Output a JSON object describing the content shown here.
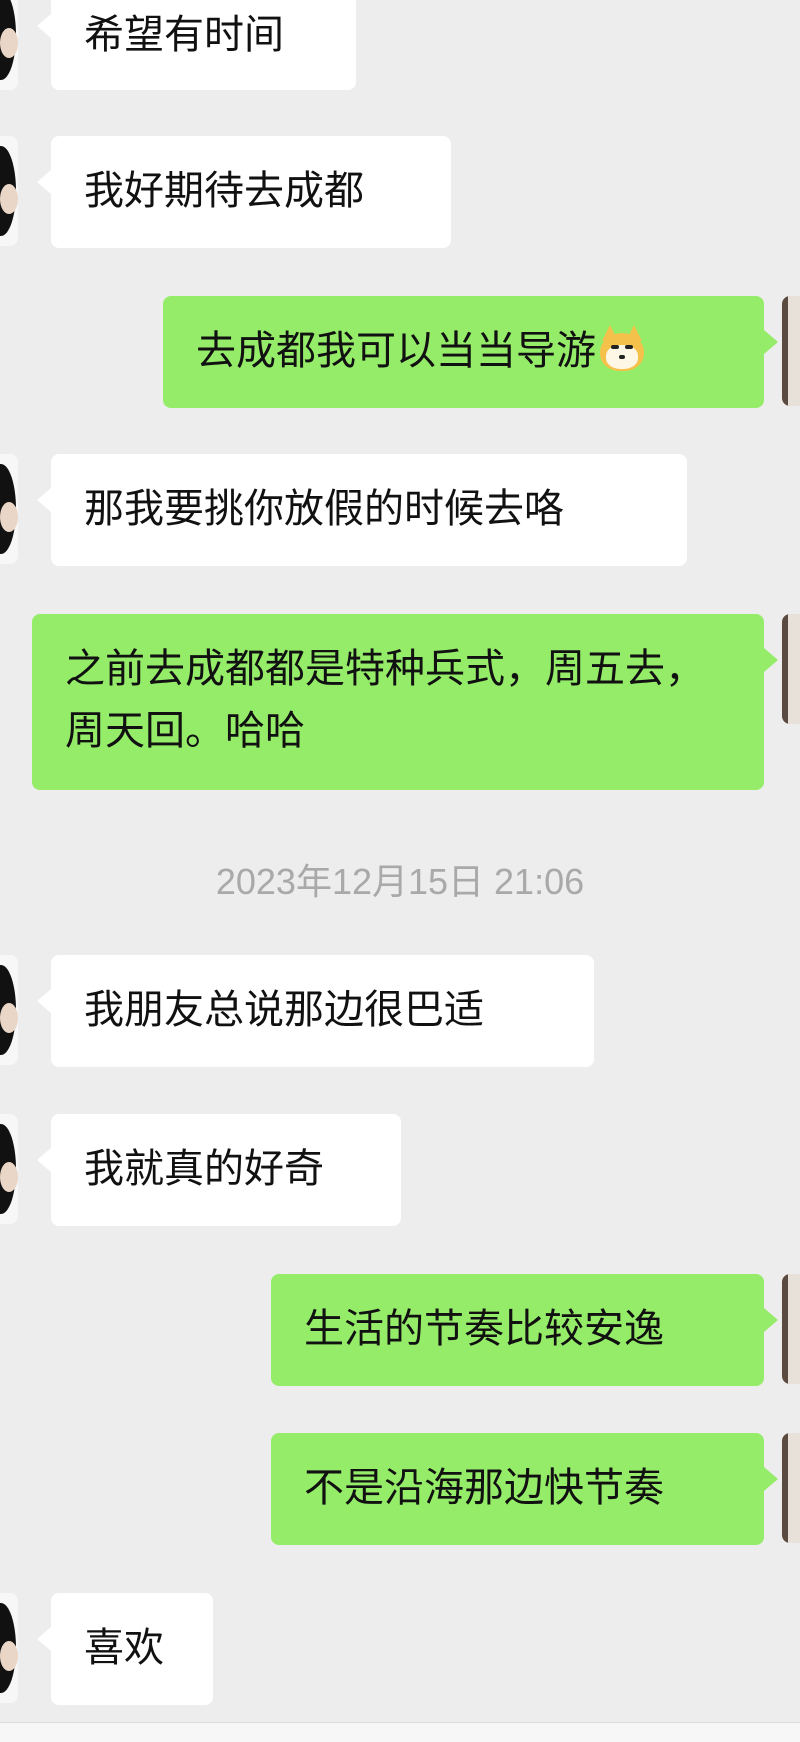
{
  "messages": [
    {
      "side": "in",
      "text": "希望有时间"
    },
    {
      "side": "in",
      "text": "我好期待去成都"
    },
    {
      "side": "out",
      "text": "去成都我可以当当导游",
      "emoji": "doge-emoji-icon"
    },
    {
      "side": "in",
      "text": "那我要挑你放假的时候去咯"
    },
    {
      "side": "out",
      "text": "之前去成都都是特种兵式，周五去，周天回。哈哈"
    },
    {
      "side": "in",
      "text": "我朋友总说那边很巴适"
    },
    {
      "side": "in",
      "text": "我就真的好奇"
    },
    {
      "side": "out",
      "text": "生活的节奏比较安逸"
    },
    {
      "side": "out",
      "text": "不是沿海那边快节奏"
    },
    {
      "side": "in",
      "text": "喜欢"
    }
  ],
  "timestamp": "2023年12月15日 21:06",
  "colors": {
    "background": "#ededed",
    "incoming_bubble": "#ffffff",
    "outgoing_bubble": "#95ec69",
    "timestamp_text": "#a9a9a9"
  }
}
